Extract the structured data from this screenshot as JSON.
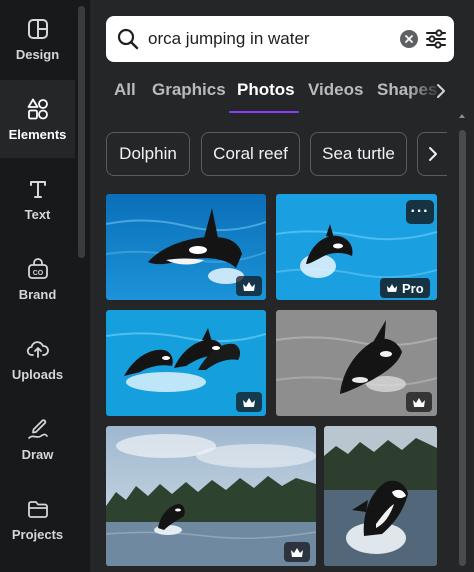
{
  "rail": {
    "items": [
      {
        "label": "Design",
        "icon": "design-icon",
        "active": false
      },
      {
        "label": "Elements",
        "icon": "elements-icon",
        "active": true
      },
      {
        "label": "Text",
        "icon": "text-icon",
        "active": false
      },
      {
        "label": "Brand",
        "icon": "brand-icon",
        "active": false
      },
      {
        "label": "Uploads",
        "icon": "uploads-icon",
        "active": false
      },
      {
        "label": "Draw",
        "icon": "draw-icon",
        "active": false
      },
      {
        "label": "Projects",
        "icon": "projects-icon",
        "active": false
      }
    ]
  },
  "search": {
    "value": "orca jumping in water",
    "icon": "search-icon",
    "clear_icon": "clear-icon",
    "filter_icon": "filter-icon"
  },
  "tabs": {
    "items": [
      "All",
      "Graphics",
      "Photos",
      "Videos",
      "Shapes"
    ],
    "active": "Photos",
    "next_icon": "chevron-right-icon"
  },
  "chips": {
    "items": [
      "Dolphin",
      "Coral reef",
      "Sea turtle"
    ],
    "next_icon": "chevron-right-icon"
  },
  "results": {
    "items": [
      {
        "subject": "orca jumping in pool",
        "badge": "crown-icon"
      },
      {
        "subject": "orca leaping in pool",
        "badge": "Pro",
        "has_more": true,
        "more_label": "···"
      },
      {
        "subject": "three orcas leaping",
        "badge": "crown-icon"
      },
      {
        "subject": "orca black and white",
        "badge": "crown-icon"
      },
      {
        "subject": "orca breaching near forest",
        "badge": "crown-icon"
      },
      {
        "subject": "orca breaching splash",
        "badge": null
      }
    ]
  },
  "colors": {
    "accent": "#8b3dff",
    "rail_bg": "#18191b",
    "panel_bg": "#252627",
    "pool_blue": "#1a9fe0"
  }
}
